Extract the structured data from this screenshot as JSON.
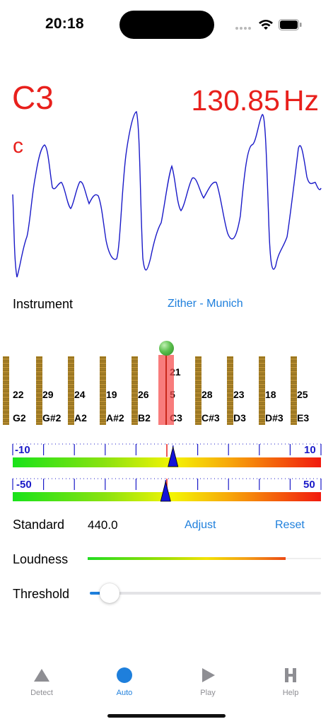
{
  "status_bar": {
    "time": "20:18",
    "icons": [
      "cellular-signal-icon",
      "wifi-icon",
      "battery-icon"
    ]
  },
  "note": {
    "name": "C3",
    "solfege": "c",
    "frequency": "130.85",
    "unit": "Hz"
  },
  "instrument": {
    "label": "Instrument",
    "value": "Zither - Munich"
  },
  "strings": {
    "items": [
      {
        "number": "22",
        "note": "G2",
        "active": false
      },
      {
        "number": "29",
        "note": "G#2",
        "active": false
      },
      {
        "number": "24",
        "note": "A2",
        "active": false
      },
      {
        "number": "19",
        "note": "A#2",
        "active": false
      },
      {
        "number": "26",
        "note": "B2",
        "active": false
      },
      {
        "number": "5",
        "upper_number": "21",
        "note": "C3",
        "active": true
      },
      {
        "number": "28",
        "note": "C#3",
        "active": false
      },
      {
        "number": "23",
        "note": "D3",
        "active": false
      },
      {
        "number": "18",
        "note": "D#3",
        "active": false
      },
      {
        "number": "25",
        "note": "E3",
        "active": false
      }
    ]
  },
  "meters": [
    {
      "min_label": "-10",
      "max_label": "10",
      "value": 0.4,
      "min": -10,
      "max": 10
    },
    {
      "min_label": "-50",
      "max_label": "50",
      "value": -0.4,
      "min": -50,
      "max": 50
    }
  ],
  "standard": {
    "label": "Standard",
    "value": "440.0",
    "adjust": "Adjust",
    "reset": "Reset"
  },
  "loudness": {
    "label": "Loudness",
    "level": 0.88
  },
  "threshold": {
    "label": "Threshold",
    "level": 0.05
  },
  "tabs": [
    {
      "label": "Detect",
      "icon": "triangle-icon",
      "active": false
    },
    {
      "label": "Auto",
      "icon": "circle-icon",
      "active": true
    },
    {
      "label": "Play",
      "icon": "play-icon",
      "active": false
    },
    {
      "label": "Help",
      "icon": "help-h-icon",
      "active": false
    }
  ],
  "colors": {
    "accent": "#1e7fdc",
    "note": "#e8201c",
    "waveform": "#1a1ac8"
  }
}
